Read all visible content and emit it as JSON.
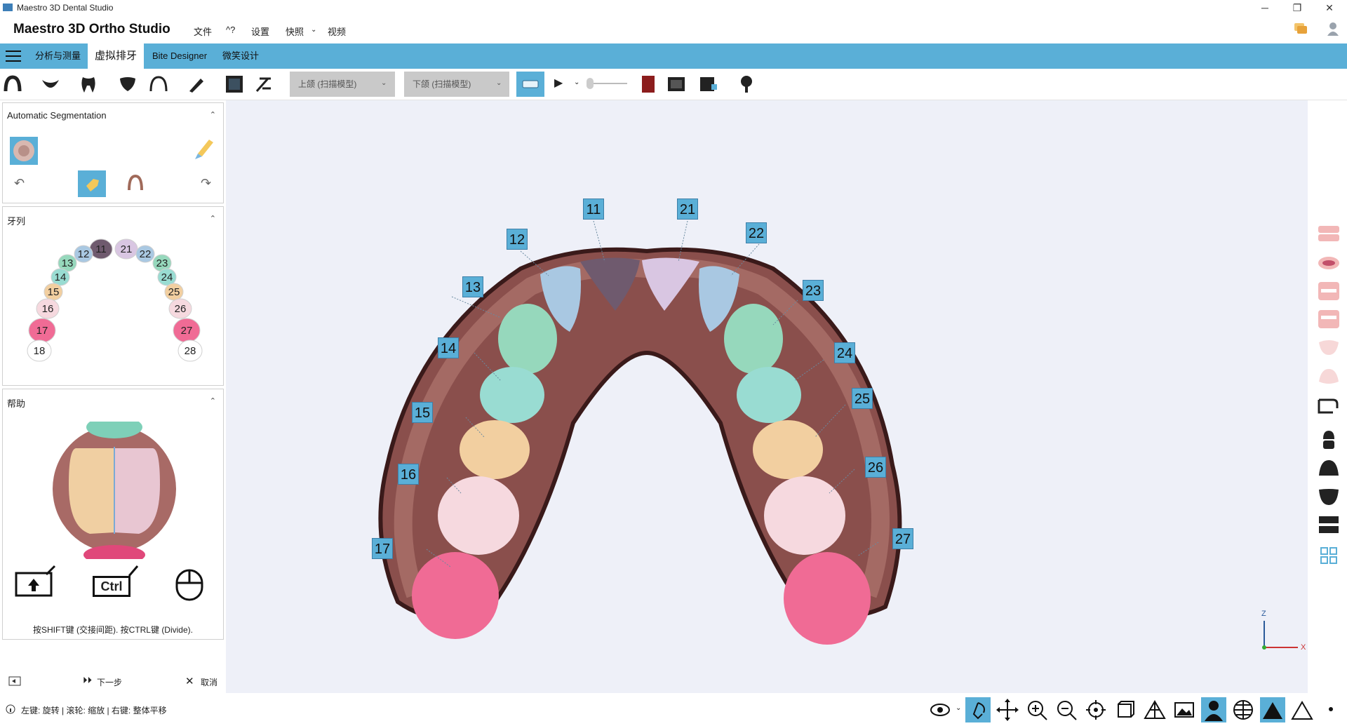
{
  "window": {
    "title": "Maestro 3D Dental Studio",
    "controls": {
      "minimize": "─",
      "maximize": "❐",
      "close": "✕"
    }
  },
  "menubar": {
    "app_title": "Maestro 3D Ortho Studio",
    "items": [
      "文件",
      "^?",
      "设置",
      "快照",
      "视频"
    ]
  },
  "tabs": {
    "items": [
      {
        "label": "分析与测量",
        "active": false
      },
      {
        "label": "虚拟排牙",
        "active": true
      },
      {
        "label": "Bite Designer",
        "active": false
      },
      {
        "label": "微笑设计",
        "active": false
      }
    ]
  },
  "toolbar": {
    "upper_jaw_select": "上颌 (扫描模型)",
    "lower_jaw_select": "下颌 (扫描模型)",
    "accent_color": "#5aafd7"
  },
  "auto_segmentation": {
    "title": "Automatic Segmentation"
  },
  "dentition_panel": {
    "title": "牙列",
    "upper_left": [
      "11",
      "12",
      "13",
      "14",
      "15",
      "16",
      "17",
      "18"
    ],
    "upper_right": [
      "21",
      "22",
      "23",
      "24",
      "25",
      "26",
      "27",
      "28"
    ]
  },
  "help_panel": {
    "title": "帮助",
    "ctrl_key": "Ctrl",
    "instruction": "按SHIFT键 (交接间距). 按CTRL键 (Divide)."
  },
  "bottom_actions": {
    "next": "下一步",
    "cancel": "取消"
  },
  "viewport": {
    "tooth_labels": [
      "11",
      "21",
      "12",
      "22",
      "13",
      "23",
      "14",
      "24",
      "15",
      "25",
      "16",
      "26",
      "17",
      "27"
    ],
    "axes": {
      "z": "Z",
      "x": "X"
    }
  },
  "statusbar": {
    "hint": "左键: 旋转 | 滚轮: 缩放 | 右键: 整体平移"
  },
  "tooth_colors": {
    "11": "#6f5a6e",
    "21": "#d9c6e2",
    "12": "#a9c8e2",
    "22": "#a9c8e2",
    "13": "#96d8bc",
    "23": "#96d8bc",
    "14": "#99dcd2",
    "24": "#99dcd2",
    "15": "#f2cfa0",
    "25": "#f2cfa0",
    "16": "#f6d9df",
    "26": "#f6d9df",
    "17": "#f06b95",
    "27": "#f06b95",
    "18": "#ffffff",
    "28": "#ffffff"
  }
}
